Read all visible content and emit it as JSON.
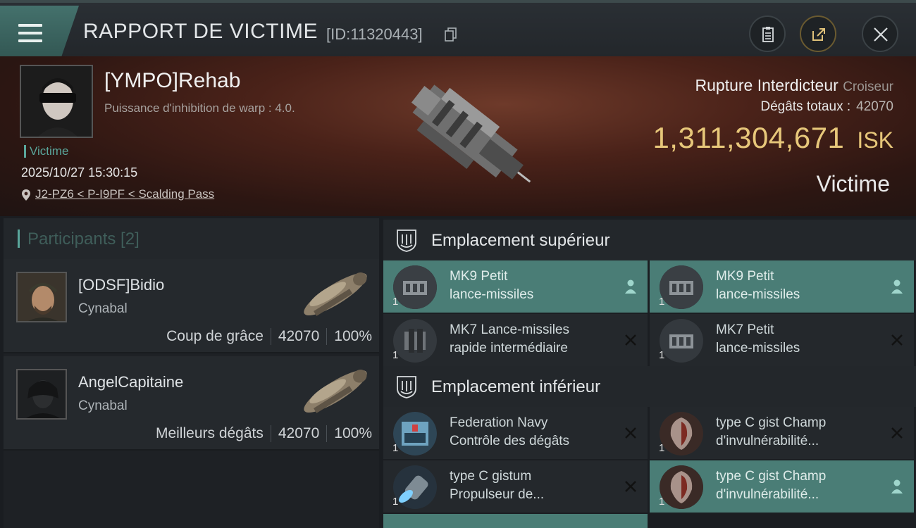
{
  "header": {
    "title": "RAPPORT DE VICTIME",
    "report_id": "[ID:11320443]"
  },
  "victim": {
    "name": "[YMPO]Rehab",
    "subtitle": "Puissance d'inhibition de warp : 4.0.",
    "role_label": "Victime",
    "datetime": "2025/10/27 15:30:15",
    "location": "J2-PZ6 < P-I9PF < Scalding Pass",
    "ship_name": "Rupture Interdicteur",
    "ship_class": "Croiseur",
    "damage_label": "Dégâts totaux :",
    "damage_value": "42070",
    "isk_value": "1,311,304,671",
    "isk_unit": "ISK",
    "status_tag": "Victime"
  },
  "participants": {
    "title": "Participants [2]",
    "items": [
      {
        "name": "[ODSF]Bidio",
        "ship": "Cynabal",
        "role": "Coup de grâce",
        "damage": "42070",
        "percent": "100%"
      },
      {
        "name": "AngelCapitaine",
        "ship": "Cynabal",
        "role": "Meilleurs dégâts",
        "damage": "42070",
        "percent": "100%"
      }
    ]
  },
  "slots": {
    "high": {
      "title": "Emplacement supérieur",
      "modules": [
        {
          "qty": "1",
          "line1": "MK9 Petit",
          "line2": "lance-missiles",
          "status": "dropped"
        },
        {
          "qty": "1",
          "line1": "MK9 Petit",
          "line2": "lance-missiles",
          "status": "dropped"
        },
        {
          "qty": "1",
          "line1": "MK7 Lance-missiles",
          "line2": "rapide intermédiaire",
          "status": "destroyed"
        },
        {
          "qty": "1",
          "line1": "MK7 Petit",
          "line2": "lance-missiles",
          "status": "destroyed"
        }
      ]
    },
    "low": {
      "title": "Emplacement inférieur",
      "modules": [
        {
          "qty": "1",
          "line1": "Federation Navy",
          "line2": "Contrôle des dégâts",
          "status": "destroyed"
        },
        {
          "qty": "1",
          "line1": "type C gist Champ",
          "line2": "d'invulnérabilité...",
          "status": "destroyed"
        },
        {
          "qty": "1",
          "line1": "type C gistum",
          "line2": "Propulseur de...",
          "status": "destroyed"
        },
        {
          "qty": "1",
          "line1": "type C gist Champ",
          "line2": "d'invulnérabilité...",
          "status": "dropped"
        }
      ]
    }
  },
  "colors": {
    "accent": "#5aa69b",
    "isk_gold": "#e7c77a",
    "dropped_bg": "#4a7d76",
    "destroyed_bg": "#24282c"
  },
  "icons": {
    "menu": "hamburger-icon",
    "copy": "copy-icon",
    "clipboard": "clipboard-icon",
    "share": "share-icon",
    "close": "close-icon",
    "location": "location-pin-icon",
    "slot_high": "high-slot-icon",
    "slot_low": "low-slot-icon",
    "dropped": "person-icon",
    "destroyed": "cross-icon"
  }
}
